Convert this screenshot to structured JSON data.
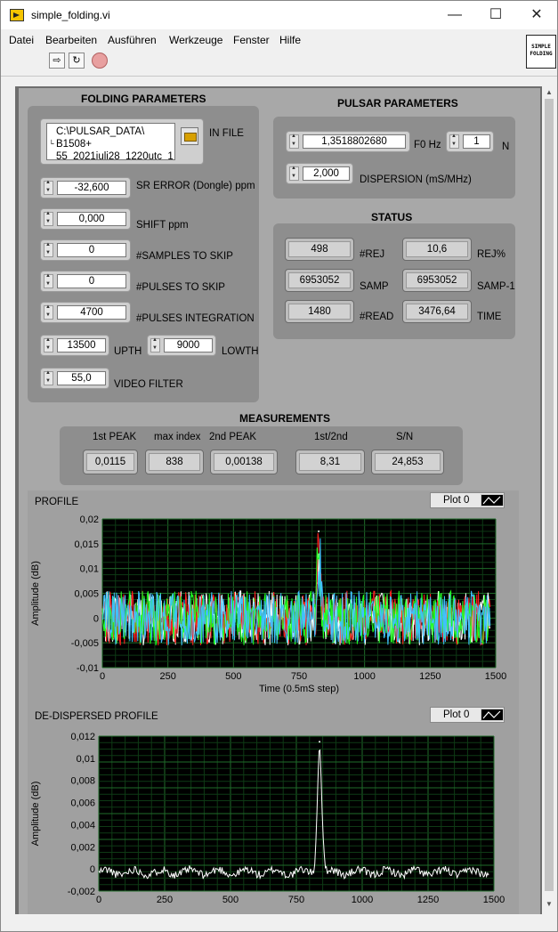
{
  "window": {
    "title": "simple_folding.vi",
    "icon_text": "SIMPLE FOLDING"
  },
  "menu": [
    "Datei",
    "Bearbeiten",
    "Ausführen",
    "Werkzeuge",
    "Fenster",
    "Hilfe"
  ],
  "folding": {
    "heading": "FOLDING PARAMETERS",
    "in_file_label": "IN FILE",
    "in_file_lines": [
      "C:\\PULSAR_DATA\\",
      "B1508+",
      "55_2021juli28_1220utc_1"
    ],
    "sr_error": {
      "label": "SR ERROR (Dongle) ppm",
      "value": "-32,600"
    },
    "shift": {
      "label": "SHIFT ppm",
      "value": "0,000"
    },
    "samples_skip": {
      "label": "#SAMPLES TO SKIP",
      "value": "0"
    },
    "pulses_skip": {
      "label": "#PULSES TO SKIP",
      "value": "0"
    },
    "pulses_integration": {
      "label": "#PULSES INTEGRATION",
      "value": "4700"
    },
    "upth": {
      "label": "UPTH",
      "value": "13500"
    },
    "lowth": {
      "label": "LOWTH",
      "value": "9000"
    },
    "video_filter": {
      "label": "VIDEO FILTER",
      "value": "55,0"
    }
  },
  "pulsar": {
    "heading": "PULSAR PARAMETERS",
    "f0": {
      "label": "F0 Hz",
      "value": "1,3518802680"
    },
    "n": {
      "label": "N",
      "value": "1"
    },
    "dispersion": {
      "label": "DISPERSION (mS/MHz)",
      "value": "2,000"
    }
  },
  "status": {
    "heading": "STATUS",
    "rej": {
      "label": "#REJ",
      "value": "498"
    },
    "rej_pct": {
      "label": "REJ%",
      "value": "10,6"
    },
    "samp": {
      "label": "SAMP",
      "value": "6953052"
    },
    "samp1": {
      "label": "SAMP-1",
      "value": "6953052"
    },
    "read": {
      "label": "#READ",
      "value": "1480"
    },
    "time": {
      "label": "TIME",
      "value": "3476,64"
    }
  },
  "measurements": {
    "heading": "MEASUREMENTS",
    "first_peak": {
      "label": "1st PEAK",
      "value": "0,0115"
    },
    "max_index": {
      "label": "max index",
      "value": "838"
    },
    "second_peak": {
      "label": "2nd PEAK",
      "value": "0,00138"
    },
    "ratio": {
      "label": "1st/2nd",
      "value": "8,31"
    },
    "sn": {
      "label": "S/N",
      "value": "24,853"
    }
  },
  "chart_data": [
    {
      "type": "line",
      "title": "PROFILE",
      "legend": "Plot 0",
      "xlabel": "Time (0.5mS step)",
      "ylabel": "Amplitude (dB)",
      "xlim": [
        0,
        1500
      ],
      "ylim": [
        -0.01,
        0.02
      ],
      "xticks": [
        "0",
        "250",
        "500",
        "750",
        "1000",
        "1250",
        "1500"
      ],
      "yticks": [
        "-0,01",
        "-0,005",
        "0",
        "0,005",
        "0,01",
        "0,015",
        "0,02"
      ],
      "grid": true,
      "background": "#000000",
      "series_colors": [
        "#ffffff",
        "#ff2020",
        "#20ff20",
        "#40c0ff"
      ],
      "peak": {
        "x": 825,
        "y": 0.0175
      },
      "noise_amplitude": 0.005
    },
    {
      "type": "line",
      "title": "DE-DISPERSED PROFILE",
      "legend": "Plot 0",
      "xlabel": "",
      "ylabel": "Amplitude (dB)",
      "xlim": [
        0,
        1500
      ],
      "ylim": [
        -0.002,
        0.012
      ],
      "xticks": [
        "0",
        "250",
        "500",
        "750",
        "1000",
        "1250",
        "1500"
      ],
      "yticks": [
        "-0,002",
        "0",
        "0,002",
        "0,004",
        "0,006",
        "0,008",
        "0,01",
        "0,012"
      ],
      "grid": true,
      "background": "#000000",
      "series_colors": [
        "#ffffff"
      ],
      "peak": {
        "x": 838,
        "y": 0.0115
      },
      "noise_amplitude": 0.0008
    }
  ]
}
